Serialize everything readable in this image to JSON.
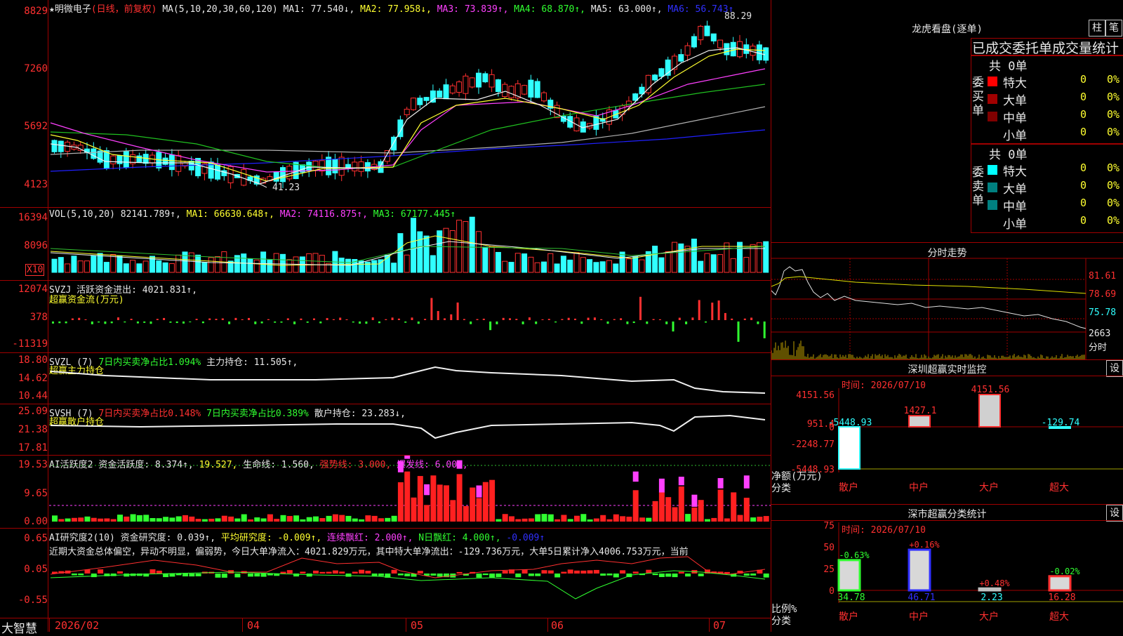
{
  "main": {
    "header": {
      "star": "★",
      "stock_name": "明微电子",
      "mode": "(日线，前复权)",
      "ma_params": "MA(5,10,20,30,60,120)",
      "ma1": "MA1: 77.540↓,",
      "ma2": "MA2: 77.958↓,",
      "ma3": "MA3: 73.839↑,",
      "ma4": "MA4: 68.870↑,",
      "ma5": "MA5: 63.000↑,",
      "ma6": "MA6: 56.743↑"
    },
    "y_ticks": [
      "8829",
      "7260",
      "5692",
      "4123"
    ],
    "high_label": "88.29",
    "low_label": "41.23"
  },
  "vol": {
    "header": "VOL(5,10,20)",
    "value": "82141.789↑,",
    "ma1": "MA1: 66630.648↑,",
    "ma2": "MA2: 74116.875↑,",
    "ma3": "MA3: 67177.445↑",
    "y_ticks": [
      "16394",
      "8096"
    ],
    "unit": "X10"
  },
  "svzj": {
    "header": "SVZJ",
    "text": "活跃资金进出: 4021.831↑,",
    "sub": "超赢资金流(万元)",
    "y_ticks": [
      "12074",
      "378",
      "-11319"
    ]
  },
  "svzl": {
    "header": "SVZL (7)",
    "t1": "7日内买卖净占比1.094%",
    "t2": "主力持仓: 11.505↑,",
    "sub": "超赢主力持仓",
    "y_ticks": [
      "18.80",
      "14.62",
      "10.44"
    ]
  },
  "svsh": {
    "header": "SVSH (7)",
    "t1": "7日内买卖净占比0.148%",
    "t2": "7日内买卖净占比0.389%",
    "t3": "散户持仓: 23.283↓,",
    "sub": "超赢散户持仓",
    "y_ticks": [
      "25.09",
      "21.38",
      "17.81"
    ]
  },
  "ai_active": {
    "header": "AI活跃度2",
    "t1": "资金活跃度: 8.374↑,",
    "t2": "19.527,",
    "t3": "生命线: 1.560,",
    "t4": "强势线: 3.000,",
    "t5": "爆发线: 6.000,",
    "y_ticks": [
      "19.53",
      "9.65",
      "0.00"
    ]
  },
  "ai_research": {
    "header": "AI研究度2(10)",
    "t1": "资金研究度: 0.039↑,",
    "t2": "平均研究度: -0.009↑,",
    "t3": "连续飘红: 2.000↑,",
    "t4": "N日飘红: 4.000↑,",
    "t5": "-0.009↑",
    "summary": "近期大资金总体偏空，异动不明显，偏弱势，今日大单净流入：4021.829万元，其中特大单净流出：-129.736万元，大单5日累计净入4006.753万元，当前",
    "y_ticks": [
      "0.65",
      "0.05",
      "-0.55"
    ]
  },
  "bottom_axis": {
    "brand": "大智慧",
    "labels": [
      "2026/02",
      "04",
      "05",
      "06",
      "07"
    ]
  },
  "right": {
    "lhb_title": "龙虎看盘(逐单)",
    "btn_zhu": "柱",
    "btn_bi": "笔",
    "deal_tabs": "已成交委托单成交量统计",
    "buy_label": "委买单",
    "sell_label": "委卖单",
    "buy_total": "共 0单",
    "sell_total": "共 0单",
    "buy_rows": [
      {
        "name": "特大",
        "count": "0",
        "pct": "0%",
        "color": "#ff0000"
      },
      {
        "name": "大单",
        "count": "0",
        "pct": "0%",
        "color": "#a00000"
      },
      {
        "name": "中单",
        "count": "0",
        "pct": "0%",
        "color": "#800000"
      },
      {
        "name": "小单",
        "count": "0",
        "pct": "0%",
        "color": "#000000"
      }
    ],
    "sell_rows": [
      {
        "name": "特大",
        "count": "0",
        "pct": "0%",
        "color": "#00ffff"
      },
      {
        "name": "大单",
        "count": "0",
        "pct": "0%",
        "color": "#008080"
      },
      {
        "name": "中单",
        "count": "0",
        "pct": "0%",
        "color": "#008080"
      },
      {
        "name": "小单",
        "count": "0",
        "pct": "0%",
        "color": "#000000"
      }
    ],
    "intraday_title": "分时走势",
    "intraday_ticks": [
      "81.61",
      "78.69",
      "75.78",
      "2663"
    ],
    "intraday_unit": "分时",
    "sz_monitor_title": "深圳超赢实时监控",
    "sz_time": "时间: 2026/07/10",
    "sz_btn": "设",
    "sz_y_ticks": [
      "4151.56",
      "951.4",
      "0",
      "-2248.77",
      "-5448.93"
    ],
    "sz_y_unit": "净额(万元)",
    "sz_x_unit": "分类",
    "sz_categories": [
      "散户",
      "中户",
      "大户",
      "超大"
    ],
    "sz_values": [
      -5448.93,
      1427.1,
      4151.56,
      -129.74
    ],
    "sz_value_labels": [
      "-5448.93",
      "1427.1",
      "4151.56",
      "-129.74"
    ],
    "stat_title": "深市超赢分类统计",
    "stat_time": "时间: 2026/07/10",
    "stat_btn": "设",
    "stat_y_ticks": [
      "75",
      "50",
      "25",
      "0"
    ],
    "stat_y_unit": "比例%",
    "stat_x_unit": "分类",
    "stat_categories": [
      "散户",
      "中户",
      "大户",
      "超大"
    ],
    "stat_values": [
      34.78,
      46.71,
      2.23,
      16.28
    ],
    "stat_value_labels": [
      "34.78",
      "46.71",
      "2.23",
      "16.28"
    ],
    "stat_change_labels": [
      "-0.63%",
      "+0.16%",
      "+0.48%",
      "-0.02%"
    ]
  }
}
